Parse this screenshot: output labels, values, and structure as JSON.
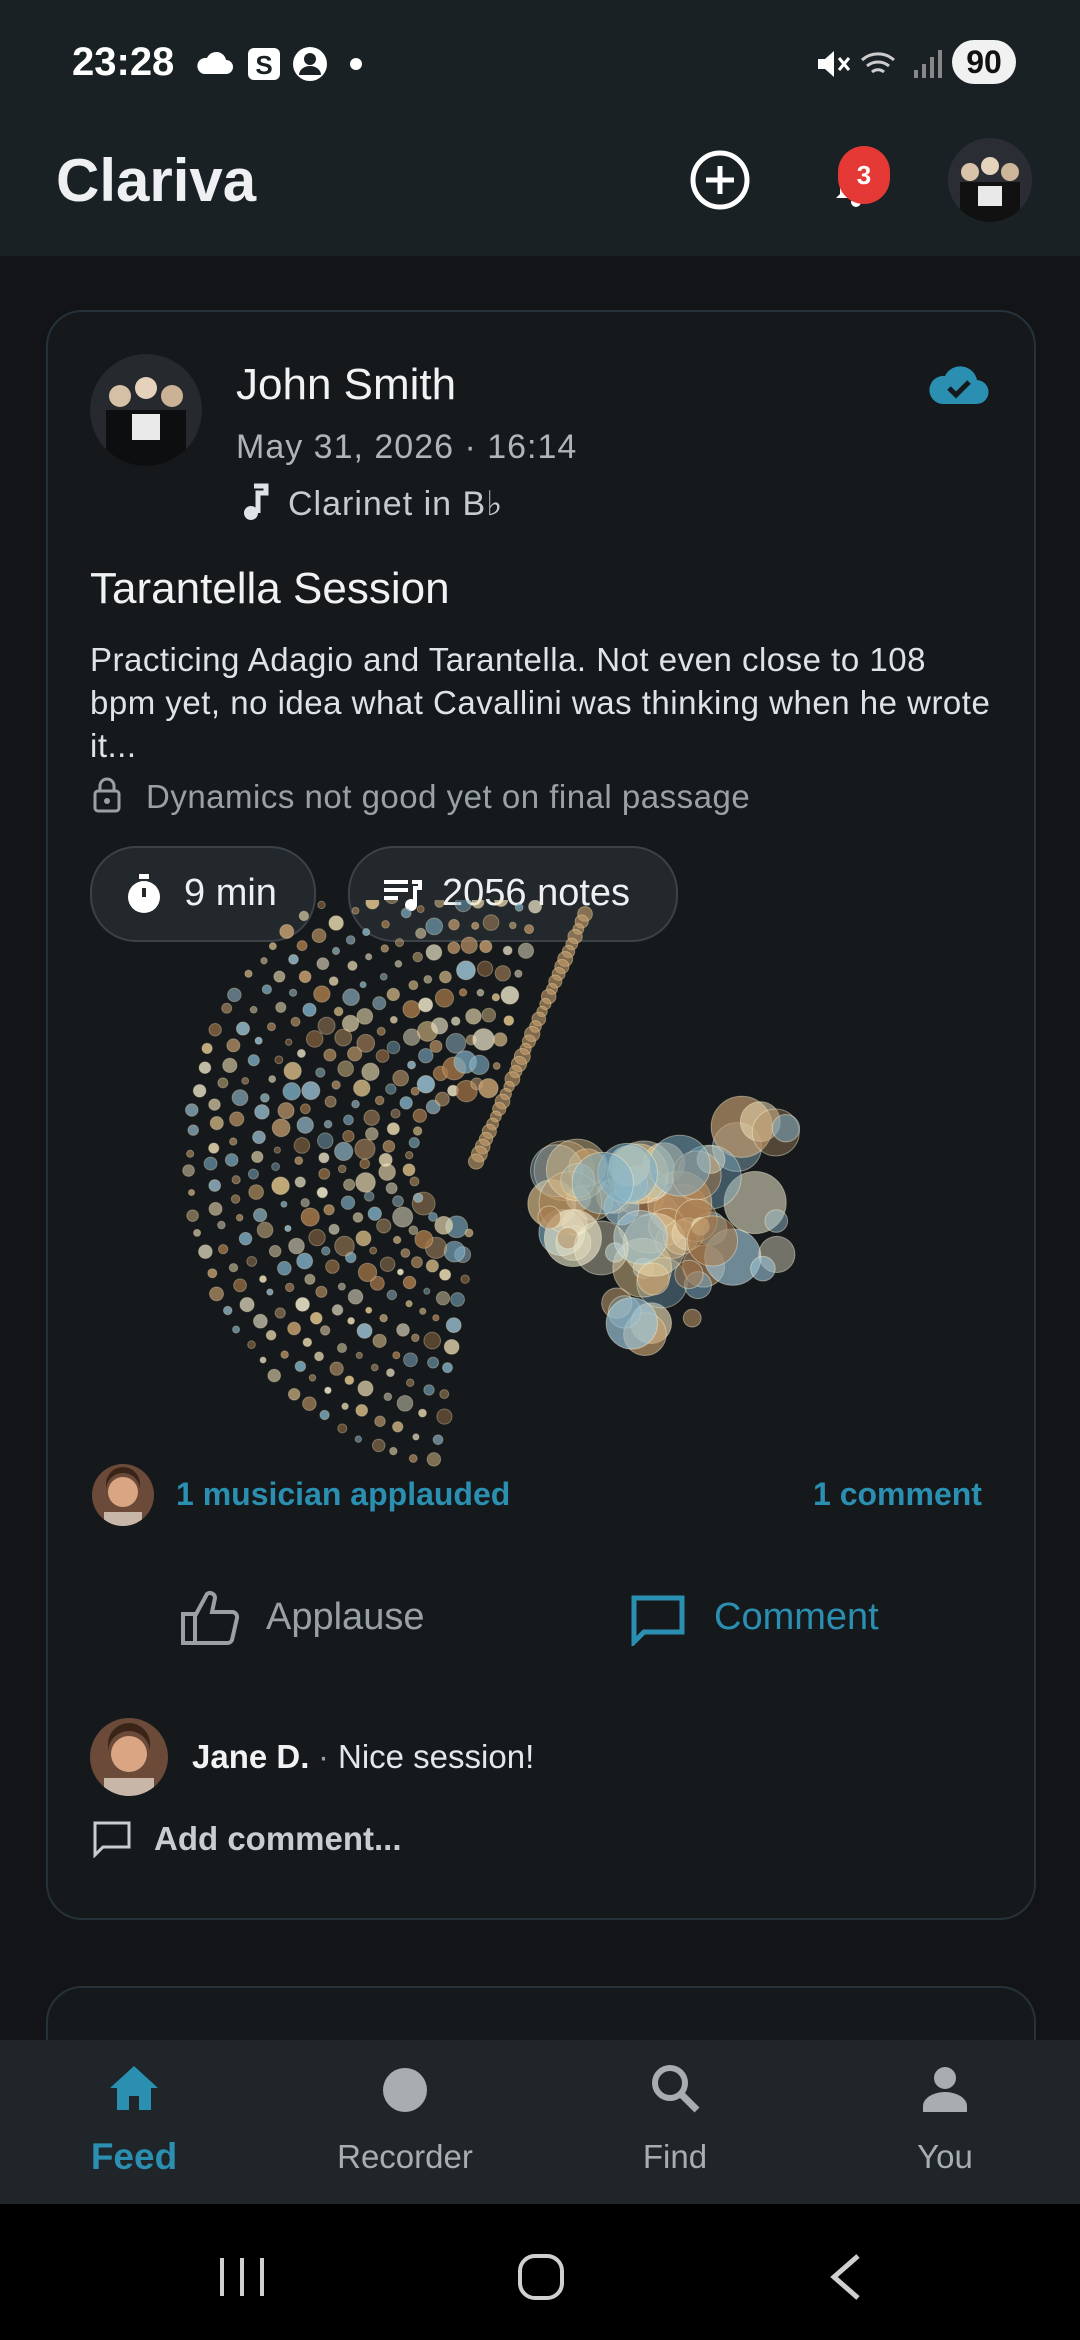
{
  "status_bar": {
    "time": "23:28",
    "battery": "90"
  },
  "app_bar": {
    "title": "Clariva",
    "notification_count": "3"
  },
  "post": {
    "author": "John Smith",
    "date": "May 31, 2026 · 16:14",
    "instrument": "Clarinet in B♭",
    "title": "Tarantella Session",
    "body": "Practicing Adagio and Tarantella. Not even close to 108 bpm yet, no idea what Cavallini was thinking when he wrote it...",
    "private_note": "Dynamics not good yet on final passage",
    "duration": "9 min",
    "notes": "2056 notes",
    "applause_text": "1 musician applauded",
    "comment_count": "1 comment",
    "applause_label": "Applause",
    "comment_label": "Comment",
    "comment": {
      "author": "Jane D.",
      "separator": "·",
      "text": "Nice session!"
    },
    "add_comment": "Add comment...",
    "accent_color": "#2a8fb1"
  },
  "bottom_nav": {
    "items": [
      {
        "label": "Feed",
        "icon": "home-icon",
        "active": true
      },
      {
        "label": "Recorder",
        "icon": "record-icon"
      },
      {
        "label": "Find",
        "icon": "search-icon"
      },
      {
        "label": "You",
        "icon": "person-icon"
      }
    ]
  }
}
